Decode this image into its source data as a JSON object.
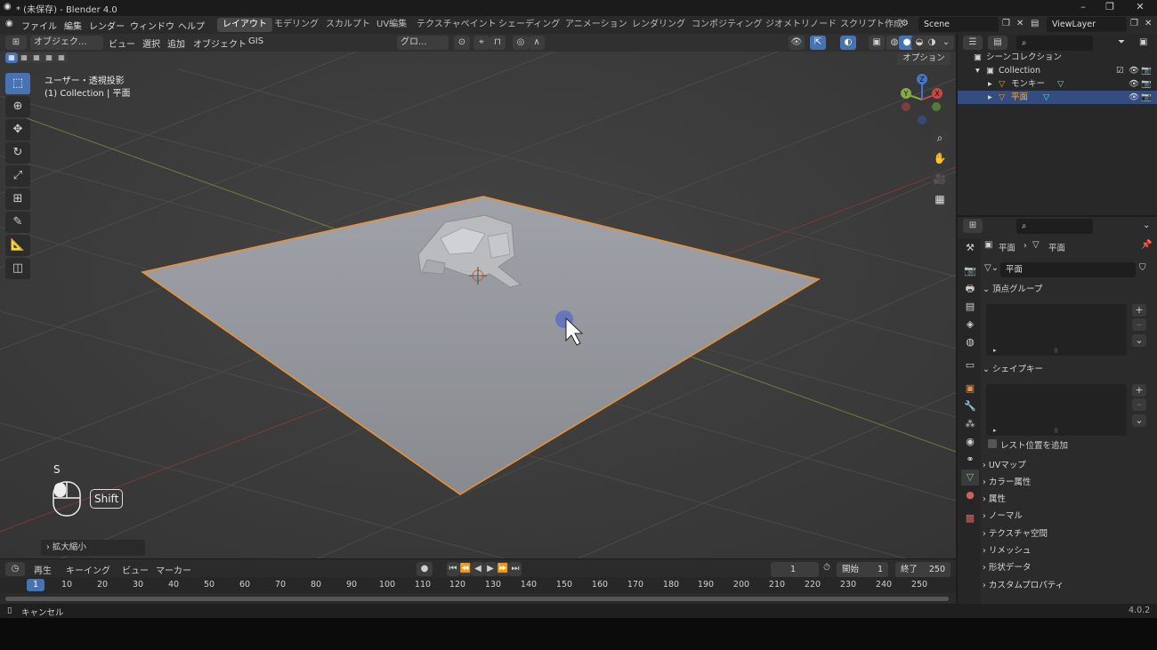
{
  "window": {
    "title": "* (未保存) - Blender 4.0"
  },
  "menu": {
    "items": [
      "ファイル",
      "編集",
      "レンダー",
      "ウィンドウ",
      "ヘルプ"
    ]
  },
  "workspaces": {
    "tabs": [
      "レイアウト",
      "モデリング",
      "スカルプト",
      "UV編集",
      "テクスチャペイント",
      "シェーディング",
      "アニメーション",
      "レンダリング",
      "コンポジティング",
      "ジオメトリノード",
      "スクリプト作成"
    ],
    "active": "レイアウト"
  },
  "scene": {
    "name": "Scene"
  },
  "viewlayer": {
    "name": "ViewLayer"
  },
  "viewport_header": {
    "mode": "オブジェク...",
    "menus": [
      "ビュー",
      "選択",
      "追加",
      "オブジェクト",
      "GIS"
    ],
    "orientation": "グロ...",
    "options_label": "オプション"
  },
  "viewport": {
    "view_name": "ユーザー・透視投影",
    "context": "(1) Collection | 平面",
    "key_hint": "S",
    "modifier_key": "Shift",
    "last_op": "拡大縮小",
    "gizmo_axes": [
      "X",
      "Y",
      "Z"
    ]
  },
  "timeline": {
    "menus": [
      "再生",
      "キーイング",
      "ビュー",
      "マーカー"
    ],
    "current_frame": "1",
    "start_label": "開始",
    "start": "1",
    "end_label": "終了",
    "end": "250",
    "ruler": [
      "1",
      "10",
      "20",
      "30",
      "40",
      "50",
      "60",
      "70",
      "80",
      "90",
      "100",
      "110",
      "120",
      "130",
      "140",
      "150",
      "160",
      "170",
      "180",
      "190",
      "200",
      "210",
      "220",
      "230",
      "240",
      "250"
    ]
  },
  "status": {
    "left": "キャンセル",
    "version": "4.0.2"
  },
  "outliner": {
    "root": "シーンコレクション",
    "collection": "Collection",
    "objects": [
      {
        "name": "モンキー",
        "selected": false
      },
      {
        "name": "平面",
        "selected": true
      }
    ]
  },
  "properties": {
    "breadcrumb_object": "平面",
    "breadcrumb_data": "平面",
    "mesh_name": "平面",
    "panels": {
      "vertex_groups": "頂点グループ",
      "shape_keys": "シェイプキー",
      "rest_position": "レスト位置を追加",
      "collapsed": [
        "UVマップ",
        "カラー属性",
        "属性",
        "ノーマル",
        "テクスチャ空間",
        "リメッシュ",
        "形状データ",
        "カスタムプロパティ"
      ]
    }
  },
  "colors": {
    "accent": "#4772b3",
    "selection_outline": "#f0902e",
    "plane_fill": "#8f9297"
  }
}
